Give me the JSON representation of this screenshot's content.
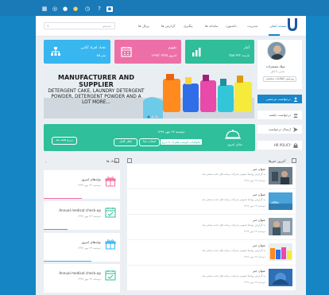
{
  "top_icons": [
    "grid-icon",
    "globe-icon",
    "bell-icon",
    "chat-icon",
    "clock-icon",
    "help-icon",
    "app-icon"
  ],
  "header": {
    "search_placeholder": "جستجو",
    "nav": [
      "صفحه اصلی",
      "مدیریت",
      "داشبورد",
      "سامانه ها",
      "پیگیری",
      "گزارش ها",
      "پرتال ها"
    ],
    "logo": "unilever-logo"
  },
  "profile": {
    "name": "میلاد محمدزاده",
    "role": "مدیر داخلی",
    "button": "ویرایش اطلاعات شخصی"
  },
  "cards": [
    {
      "title": "تعداد افراد آنلاین",
      "value": "۸۵ نفر",
      "color": "#37b6f0",
      "icon": "org-chart-icon"
    },
    {
      "title": "تقویم",
      "value": "امروز ۱۳۹۷/۰۷/۲۵",
      "color": "#ee6fa7",
      "icon": "calendar-icon"
    },
    {
      "title": "آمار",
      "value": "۲۵۸٬۳۲۲ بازدید",
      "color": "#2fbd9a",
      "icon": "chart-icon"
    }
  ],
  "banner": {
    "line1": "MANUFACTURER AND",
    "line2": "SUPPLIER",
    "line3": "DETERGENT CAKE, LAUNDRY DETERGENT",
    "line4": "POWDER, DETERGENT POWDER AND A",
    "line5": "LOT MORE..."
  },
  "sidebar": [
    {
      "label": "درخواست مرخصی",
      "icon": "person-icon",
      "active": true
    },
    {
      "label": "درخواست جلسه",
      "icon": "people-icon",
      "active": false
    },
    {
      "label": "ارسال درخواست",
      "icon": "send-icon",
      "active": false
    },
    {
      "label": "HR POLICY",
      "icon": "lock-icon",
      "active": false
    }
  ],
  "reservation": {
    "title": "غذای امروز",
    "date": "دوشنبه ۲۳ مهر ۱۳۹۷",
    "food": "چلوکباب کوبیده همراه با مرغ",
    "btn_food": "انتخاب غذا",
    "btn_more": "ناهار کامل",
    "btn_reserve": "رزرو هفته بعد"
  },
  "sections": {
    "left": "رویداد ها",
    "right": "آخرین خبرها"
  },
  "events": [
    {
      "title": "تولدهای امروز",
      "sub": "دوشنبه ۲۳ مهر ۱۳۹۷",
      "icon": "gift-icon",
      "color": "#f36d9c"
    },
    {
      "title": "Annual medical check-up",
      "sub": "دوشنبه ۲۳ مهر ۱۳۹۷",
      "icon": "calendar-check-icon",
      "color": "#2fbd9a"
    },
    {
      "title": "تولدهای امروز",
      "sub": "دوشنبه ۲۳ مهر ۱۳۹۷",
      "icon": "gift-icon",
      "color": "#37b6f0"
    },
    {
      "title": "Annual medical check-up",
      "sub": "دوشنبه ۲۳ مهر ۱۳۹۷",
      "icon": "calendar-check-icon",
      "color": "#2fbd9a"
    }
  ],
  "news": [
    {
      "title": "عنوان خبر",
      "desc": "به گزارش روابط عمومی شرکت برنامه های جدید منتشر شد",
      "date": "دوشنبه ۲۳ مهر ۱۳۹۷"
    },
    {
      "title": "عنوان خبر",
      "desc": "به گزارش روابط عمومی شرکت برنامه های جدید منتشر شد",
      "date": "دوشنبه ۲۳ مهر ۱۳۹۷"
    },
    {
      "title": "عنوان خبر",
      "desc": "به گزارش روابط عمومی شرکت برنامه های جدید منتشر شد",
      "date": "دوشنبه ۲۳ مهر ۱۳۹۷"
    },
    {
      "title": "عنوان خبر",
      "desc": "به گزارش روابط عمومی شرکت برنامه های جدید منتشر شد",
      "date": "دوشنبه ۲۳ مهر ۱۳۹۷"
    },
    {
      "title": "عنوان خبر",
      "desc": "به گزارش روابط عمومی شرکت برنامه های جدید منتشر شد",
      "date": "دوشنبه ۲۳ مهر ۱۳۹۷"
    }
  ]
}
